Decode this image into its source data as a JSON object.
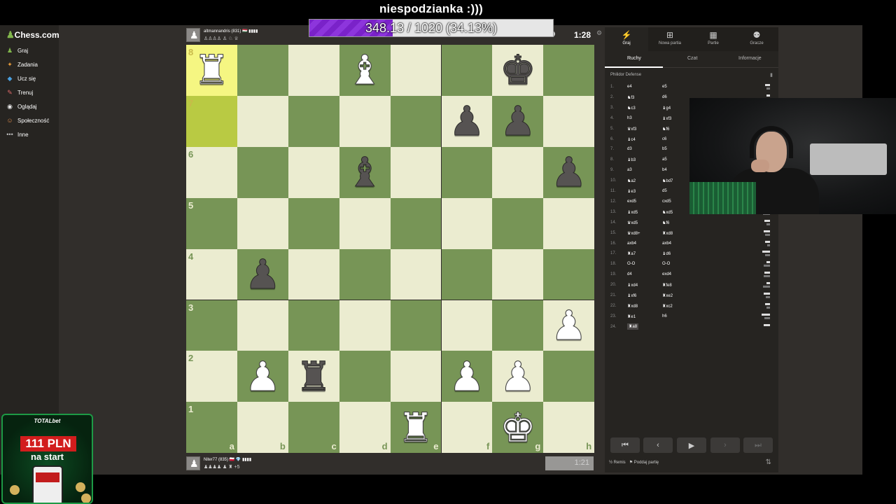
{
  "stream": {
    "title": "niespodzianka :)))",
    "goal_text": "348.13 / 1020 (34.13%)",
    "goal_fraction": 0.3413
  },
  "sidebar": {
    "logo": "Chess.com",
    "items": [
      {
        "label": "Graj",
        "icon": "play-icon"
      },
      {
        "label": "Zadania",
        "icon": "puzzle-icon"
      },
      {
        "label": "Ucz się",
        "icon": "learn-icon"
      },
      {
        "label": "Trenuj",
        "icon": "train-icon"
      },
      {
        "label": "Oglądaj",
        "icon": "watch-icon"
      },
      {
        "label": "Społeczność",
        "icon": "community-icon"
      },
      {
        "label": "Inne",
        "icon": "more-icon"
      }
    ]
  },
  "top_player": {
    "name": "altmannandris (831) 🇭🇺 ▮▮▮▮",
    "captured": "♙♙♙♙ ♙ ♘ ♕",
    "clock": "1:28"
  },
  "bottom_player": {
    "name": "Niter77 (835) 🇵🇱 💎 ▮▮▮▮",
    "captured": "♟♟♟♟ ♟ ♜ +5",
    "clock": "1:21"
  },
  "board": {
    "ranks": [
      "8",
      "7",
      "6",
      "5",
      "4",
      "3",
      "2",
      "1"
    ],
    "files": [
      "a",
      "b",
      "c",
      "d",
      "e",
      "f",
      "g",
      "h"
    ],
    "highlighted": [
      "a8",
      "a7"
    ],
    "pieces": [
      {
        "sq": "a8",
        "glyph": "♜",
        "color": "w"
      },
      {
        "sq": "d8",
        "glyph": "♝",
        "color": "w"
      },
      {
        "sq": "g8",
        "glyph": "♚",
        "color": "b"
      },
      {
        "sq": "f7",
        "glyph": "♟",
        "color": "b"
      },
      {
        "sq": "g7",
        "glyph": "♟",
        "color": "b"
      },
      {
        "sq": "d6",
        "glyph": "♝",
        "color": "b"
      },
      {
        "sq": "h6",
        "glyph": "♟",
        "color": "b"
      },
      {
        "sq": "b4",
        "glyph": "♟",
        "color": "b"
      },
      {
        "sq": "h3",
        "glyph": "♟",
        "color": "w"
      },
      {
        "sq": "b2",
        "glyph": "♟",
        "color": "w"
      },
      {
        "sq": "c2",
        "glyph": "♜",
        "color": "b"
      },
      {
        "sq": "f2",
        "glyph": "♟",
        "color": "w"
      },
      {
        "sq": "g2",
        "glyph": "♟",
        "color": "w"
      },
      {
        "sq": "e1",
        "glyph": "♜",
        "color": "w"
      },
      {
        "sq": "g1",
        "glyph": "♚",
        "color": "w"
      }
    ]
  },
  "panel": {
    "tabs": [
      {
        "label": "Graj",
        "icon": "bolt-icon"
      },
      {
        "label": "Nowa partia",
        "icon": "plus-icon"
      },
      {
        "label": "Partie",
        "icon": "games-icon"
      },
      {
        "label": "Gracze",
        "icon": "players-icon"
      }
    ],
    "sub_tabs": [
      "Ruchy",
      "Czat",
      "Informacje"
    ],
    "opening": "Philidor Defense",
    "moves": [
      {
        "n": "1.",
        "w": "e4",
        "b": "e5"
      },
      {
        "n": "2.",
        "w": "♞f3",
        "b": "d6"
      },
      {
        "n": "3.",
        "w": "♞c3",
        "b": "♝g4"
      },
      {
        "n": "4.",
        "w": "h3",
        "b": "♝xf3"
      },
      {
        "n": "5.",
        "w": "♛xf3",
        "b": "♞f6"
      },
      {
        "n": "6.",
        "w": "♝c4",
        "b": "c6"
      },
      {
        "n": "7.",
        "w": "d3",
        "b": "b5"
      },
      {
        "n": "8.",
        "w": "♝b3",
        "b": "a5"
      },
      {
        "n": "9.",
        "w": "a3",
        "b": "b4"
      },
      {
        "n": "10.",
        "w": "♞a2",
        "b": "♞bd7"
      },
      {
        "n": "11.",
        "w": "♝e3",
        "b": "d5"
      },
      {
        "n": "12.",
        "w": "exd5",
        "b": "cxd5"
      },
      {
        "n": "13.",
        "w": "♝xd5",
        "b": "♞xd5"
      },
      {
        "n": "14.",
        "w": "♛xd5",
        "b": "♞f6"
      },
      {
        "n": "15.",
        "w": "♛xd8+",
        "b": "♜xd8"
      },
      {
        "n": "16.",
        "w": "axb4",
        "b": "axb4"
      },
      {
        "n": "17.",
        "w": "♜a7",
        "b": "♝d6"
      },
      {
        "n": "18.",
        "w": "O-O",
        "b": "O-O"
      },
      {
        "n": "19.",
        "w": "d4",
        "b": "exd4"
      },
      {
        "n": "20.",
        "w": "♝xd4",
        "b": "♜fe8"
      },
      {
        "n": "21.",
        "w": "♝xf6",
        "b": "♜xe2"
      },
      {
        "n": "22.",
        "w": "♜xd8",
        "b": "♜xc2"
      },
      {
        "n": "23.",
        "w": "♜e1",
        "b": "h6"
      },
      {
        "n": "24.",
        "w": "♜a8",
        "b": ""
      }
    ],
    "footer_draw": "½ Remis",
    "footer_resign": "Poddaj partię"
  },
  "ad": {
    "brand": "TOTALbet",
    "amount": "111 PLN",
    "sub": "na start"
  }
}
